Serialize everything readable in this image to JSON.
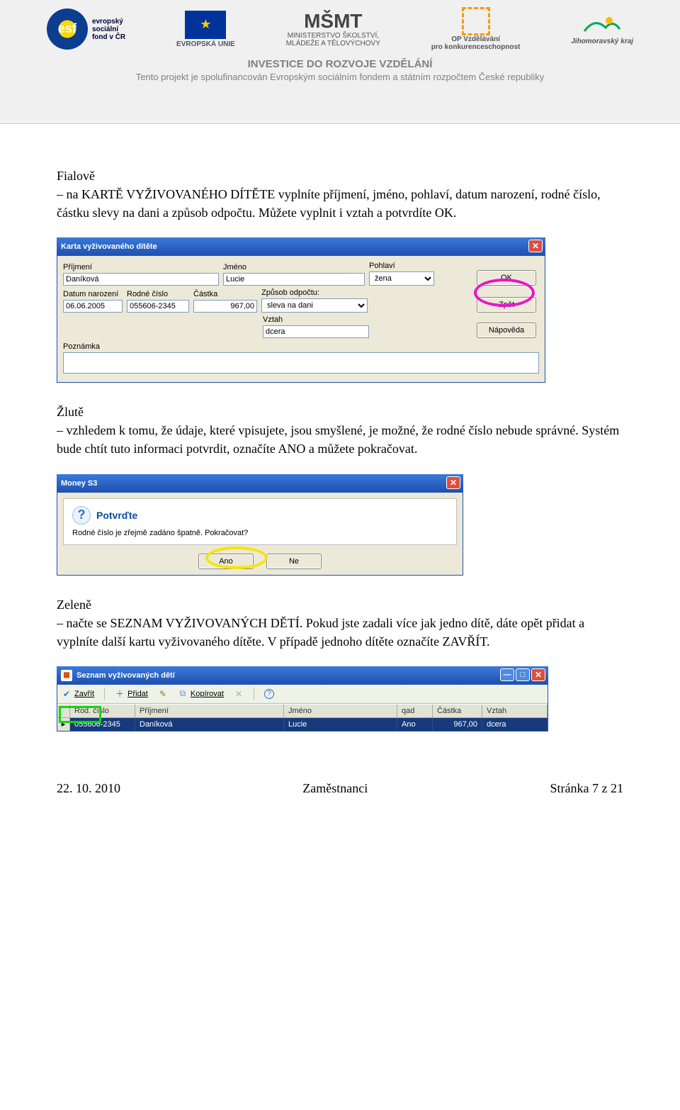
{
  "banner": {
    "esf_line1": "evropský",
    "esf_line2": "sociální",
    "esf_line3": "fond v ČR",
    "eu_label": "EVROPSKÁ UNIE",
    "msmt_label": "MŠMT",
    "msmt_line1": "MINISTERSTVO ŠKOLSTVÍ,",
    "msmt_line2": "MLÁDEŽE A TĚLOVÝCHOVY",
    "op_line1": "OP Vzdělávání",
    "op_line2": "pro konkurenceschopnost",
    "jmk_label": "Jihomoravský kraj",
    "strap": "INVESTICE DO ROZVOJE VZDĚLÁNÍ",
    "sub": "Tento projekt je spolufinancován Evropským sociálním fondem a státním rozpočtem České republiky"
  },
  "para1": {
    "head": "Fialově",
    "body": "– na KARTĚ VYŽIVOVANÉHO DÍTĚTE vyplníte příjmení, jméno, pohlaví, datum narození, rodné číslo, částku slevy na dani a způsob odpočtu. Můžete vyplnit i vztah a potvrdíte OK."
  },
  "karta": {
    "title": "Karta vyživovaného dítěte",
    "lbl_prijmeni": "Příjmení",
    "lbl_jmeno": "Jméno",
    "lbl_pohlavi": "Pohlaví",
    "lbl_datum": "Datum narození",
    "lbl_rodne": "Rodné číslo",
    "lbl_castka": "Částka",
    "lbl_zpusob": "Způsob odpočtu:",
    "lbl_vztah": "Vztah",
    "lbl_poznamka": "Poznámka",
    "val_prijmeni": "Daníková",
    "val_jmeno": "Lucie",
    "val_pohlavi": "žena",
    "val_datum": "06.06.2005",
    "val_rodne": "055606-2345",
    "val_castka": "967,00",
    "val_zpusob": "sleva na dani",
    "val_vztah": "dcera",
    "val_poznamka": "",
    "btn_ok": "OK",
    "btn_zpet": "Zpět",
    "btn_napoveda": "Nápověda"
  },
  "para2": {
    "head": "Žlutě",
    "body": "– vzhledem k tomu, že údaje, které vpisujete, jsou smyšlené, je možné, že rodné číslo nebude správné. Systém bude chtít tuto informaci potvrdit, označíte ANO a můžete pokračovat."
  },
  "confirm": {
    "title": "Money S3",
    "header": "Potvrďte",
    "message": "Rodné číslo je zřejmě zadáno špatně. Pokračovat?",
    "btn_ano": "Ano",
    "btn_ne": "Ne"
  },
  "para3": {
    "head": "Zeleně",
    "body": "– načte se SEZNAM VYŽIVOVANÝCH DĚTÍ. Pokud jste zadali více jak jedno dítě, dáte opět přidat a vyplníte další kartu vyživovaného dítěte. V případě jednoho dítěte označíte ZAVŘÍT."
  },
  "seznam": {
    "title": "Seznam vyživovaných dětí",
    "tb_zavrit": "Zavřít",
    "tb_pridat": "Přidat",
    "tb_kopirovat": "Kopírovat",
    "col_rod": "Rod. číslo",
    "col_prijmeni": "Příjmení",
    "col_jmeno": "Jméno",
    "col_qad": "qad",
    "col_castka": "Částka",
    "col_vztah": "Vztah",
    "row_rod": "055606-2345",
    "row_prijmeni": "Daníková",
    "row_jmeno": "Lucie",
    "row_qad": "Ano",
    "row_castka": "967,00",
    "row_vztah": "dcera"
  },
  "footer": {
    "left": "22. 10. 2010",
    "center": "Zaměstnanci",
    "right": "Stránka 7 z 21"
  }
}
